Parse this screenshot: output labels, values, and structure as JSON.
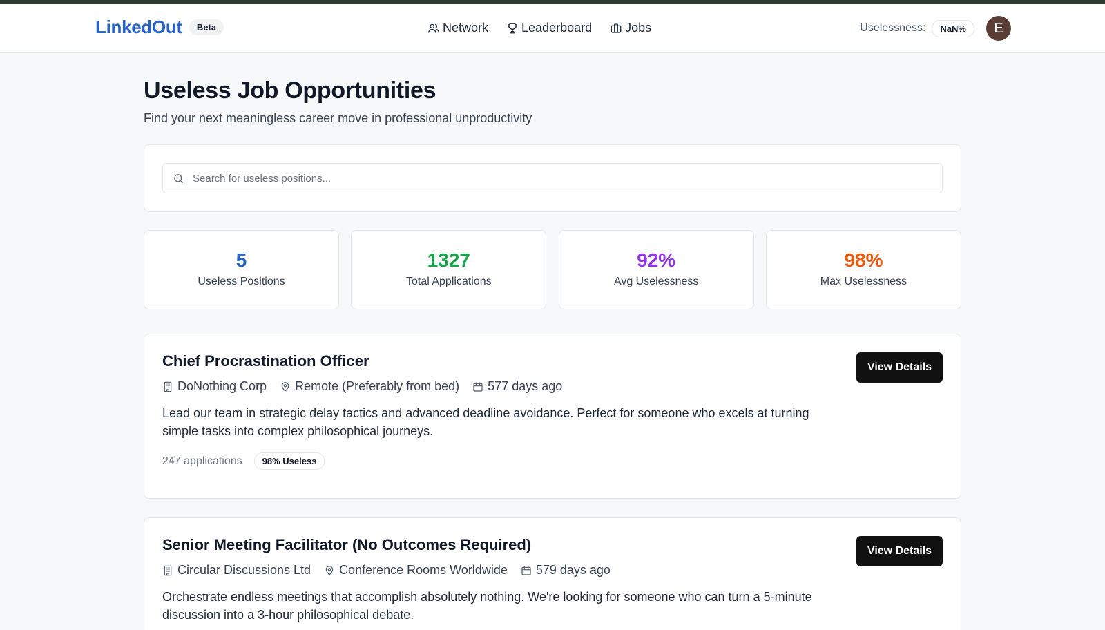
{
  "nav": {
    "brand": "LinkedOut",
    "beta": "Beta",
    "links": [
      {
        "label": "Network",
        "icon": "users-icon"
      },
      {
        "label": "Leaderboard",
        "icon": "trophy-icon"
      },
      {
        "label": "Jobs",
        "icon": "briefcase-icon"
      }
    ],
    "uselessness_label": "Uselessness:",
    "uselessness_value": "NaN%",
    "avatar_initial": "E"
  },
  "page": {
    "title": "Useless Job Opportunities",
    "subtitle": "Find your next meaningless career move in professional unproductivity"
  },
  "search": {
    "placeholder": "Search for useless positions...",
    "value": ""
  },
  "stats": [
    {
      "value": "5",
      "label": "Useless Positions",
      "color": "#2563c9"
    },
    {
      "value": "1327",
      "label": "Total Applications",
      "color": "#16a34a"
    },
    {
      "value": "92%",
      "label": "Avg Uselessness",
      "color": "#9333ea"
    },
    {
      "value": "98%",
      "label": "Max Uselessness",
      "color": "#ea580c"
    }
  ],
  "jobs": [
    {
      "title": "Chief Procrastination Officer",
      "company": "DoNothing Corp",
      "location": "Remote (Preferably from bed)",
      "posted": "577 days ago",
      "description": "Lead our team in strategic delay tactics and advanced deadline avoidance. Perfect for someone who excels at turning simple tasks into complex philosophical journeys.",
      "applications": "247 applications",
      "badge": "98% Useless",
      "button": "View Details"
    },
    {
      "title": "Senior Meeting Facilitator (No Outcomes Required)",
      "company": "Circular Discussions Ltd",
      "location": "Conference Rooms Worldwide",
      "posted": "579 days ago",
      "description": "Orchestrate endless meetings that accomplish absolutely nothing. We're looking for someone who can turn a 5-minute discussion into a 3-hour philosophical debate.",
      "button": "View Details"
    }
  ]
}
